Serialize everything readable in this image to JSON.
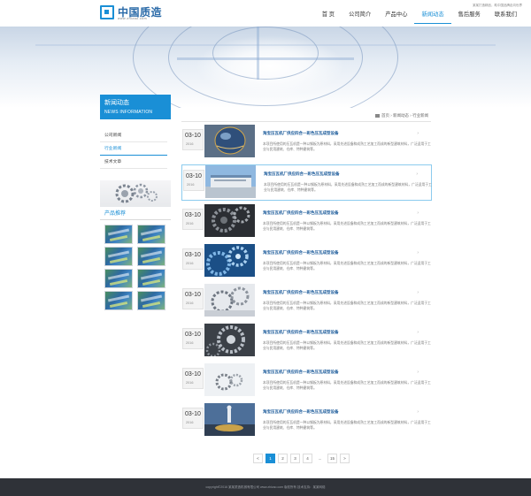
{
  "header": {
    "logo_text": "中国质造",
    "logo_sub": "www.zhizao.com",
    "note": "某某打造精品，助中国品牌走向世界",
    "nav": [
      {
        "label": "首 页"
      },
      {
        "label": "公司简介"
      },
      {
        "label": "产品中心"
      },
      {
        "label": "新闻动态"
      },
      {
        "label": "售后服务"
      },
      {
        "label": "联系我们"
      }
    ],
    "active_nav": "新闻动态"
  },
  "sidebar": {
    "title": "新闻动态",
    "title_en": "NEWS INFORMATION",
    "items": [
      {
        "label": "公司新闻"
      },
      {
        "label": "行业新闻"
      },
      {
        "label": "技术文章"
      }
    ],
    "active_item": "行业新闻",
    "products_title": "产品推荐",
    "product_count": 8
  },
  "breadcrumb": {
    "home": "首页",
    "sep1": "›",
    "level1": "新闻动态",
    "sep2": "›",
    "level2": "行业新闻"
  },
  "news": [
    {
      "md": "03-10",
      "year": "2016",
      "title": "淘宝压瓦机厂供应四合一彩色压瓦成型设备",
      "desc": "本项目所使用的压瓦机是一种以钢板为原材料，采用先进设备和成熟工艺加工而成的新型建筑材料，广泛适用于工业与民用建筑、仓库、特种建筑等。",
      "thumb": "globe"
    },
    {
      "md": "03-10",
      "year": "2016",
      "title": "淘宝压瓦机厂供应四合一彩色压瓦成型设备",
      "desc": "本项目所使用的压瓦机是一种以钢板为原材料，采用先进设备和成熟工艺加工而成的新型建筑材料，广泛适用于工业与民用建筑、仓库、特种建筑等。",
      "thumb": "factory"
    },
    {
      "md": "03-10",
      "year": "2016",
      "title": "淘宝压瓦机厂供应四合一彩色压瓦成型设备",
      "desc": "本项目所使用的压瓦机是一种以钢板为原材料，采用先进设备和成熟工艺加工而成的新型建筑材料，广泛适用于工业与民用建筑、仓库、特种建筑等。",
      "thumb": "gears-dark"
    },
    {
      "md": "03-10",
      "year": "2016",
      "title": "淘宝压瓦机厂供应四合一彩色压瓦成型设备",
      "desc": "本项目所使用的压瓦机是一种以钢板为原材料，采用先进设备和成熟工艺加工而成的新型建筑材料，广泛适用于工业与民用建筑、仓库、特种建筑等。",
      "thumb": "gears-blue"
    },
    {
      "md": "03-10",
      "year": "2016",
      "title": "淘宝压瓦机厂供应四合一彩色压瓦成型设备",
      "desc": "本项目所使用的压瓦机是一种以钢板为原材料，采用先进设备和成熟工艺加工而成的新型建筑材料，广泛适用于工业与民用建筑、仓库、特种建筑等。",
      "thumb": "gears-white"
    },
    {
      "md": "03-10",
      "year": "2016",
      "title": "淘宝压瓦机厂供应四合一彩色压瓦成型设备",
      "desc": "本项目所使用的压瓦机是一种以钢板为原材料，采用先进设备和成熟工艺加工而成的新型建筑材料，广泛适用于工业与民用建筑、仓库、特种建筑等。",
      "thumb": "gears-steel"
    },
    {
      "md": "03-10",
      "year": "2016",
      "title": "淘宝压瓦机厂供应四合一彩色压瓦成型设备",
      "desc": "本项目所使用的压瓦机是一种以钢板为原材料，采用先进设备和成熟工艺加工而成的新型建筑材料，广泛适用于工业与民用建筑、仓库、特种建筑等。",
      "thumb": "gears-light"
    },
    {
      "md": "03-10",
      "year": "2016",
      "title": "淘宝压瓦机厂供应四合一彩色压瓦成型设备",
      "desc": "本项目所使用的压瓦机是一种以钢板为原材料，采用先进设备和成熟工艺加工而成的新型建筑材料，广泛适用于工业与民用建筑、仓库、特种建筑等。",
      "thumb": "business"
    }
  ],
  "highlighted_index": 1,
  "more_arrow": "›",
  "pagination": [
    "<",
    "1",
    "2",
    "3",
    "4",
    "...",
    "15",
    ">"
  ],
  "current_page": "1",
  "footer": {
    "text": "copyright©2016 某某质造机械有限公司 www.zhizao.com 版权所有 技术支持：某某网络"
  },
  "colors": {
    "accent": "#1a8fd6",
    "footer_bg": "#2f3238"
  }
}
